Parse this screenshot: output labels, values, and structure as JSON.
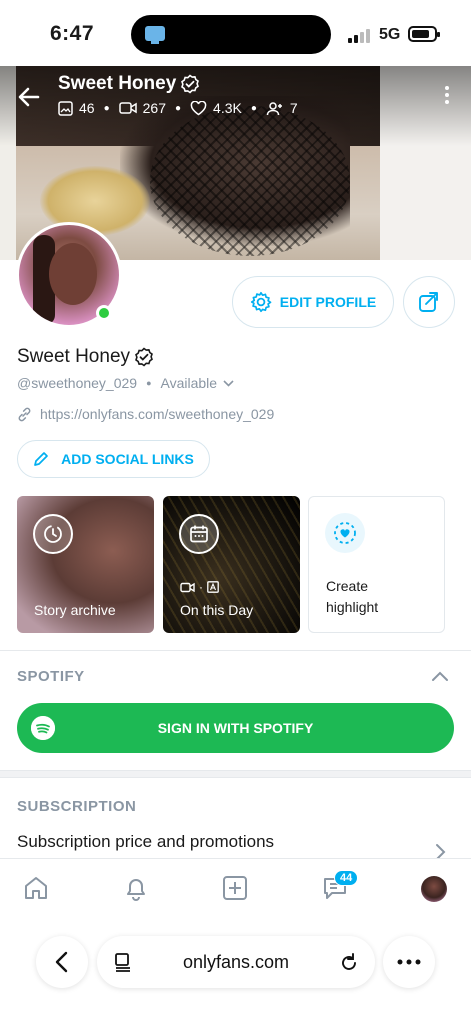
{
  "status_bar": {
    "time": "6:47",
    "network": "5G"
  },
  "profile": {
    "cover_title": "Sweet Honey",
    "stats": {
      "photos": "46",
      "videos": "267",
      "likes": "4.3K",
      "subscribers": "7"
    },
    "name": "Sweet Honey",
    "handle": "@sweethoney_029",
    "availability": "Available",
    "link": "https://onlyfans.com/sweethoney_029",
    "online_color": "#2ecc40"
  },
  "actions": {
    "edit_profile": "EDIT PROFILE",
    "add_social_links": "ADD SOCIAL LINKS"
  },
  "highlights": [
    {
      "label": "Story archive"
    },
    {
      "label": "On this Day"
    },
    {
      "label_line1": "Create",
      "label_line2": "highlight"
    }
  ],
  "spotify": {
    "section_title": "SPOTIFY",
    "button_label": "SIGN IN WITH SPOTIFY",
    "color": "#1db954"
  },
  "subscription": {
    "section_title": "SUBSCRIPTION",
    "row_label": "Subscription price and promotions"
  },
  "bottom_nav": {
    "messages_badge": "44"
  },
  "browser": {
    "url": "onlyfans.com"
  },
  "colors": {
    "accent": "#00aff0",
    "muted": "#8a96a3"
  }
}
